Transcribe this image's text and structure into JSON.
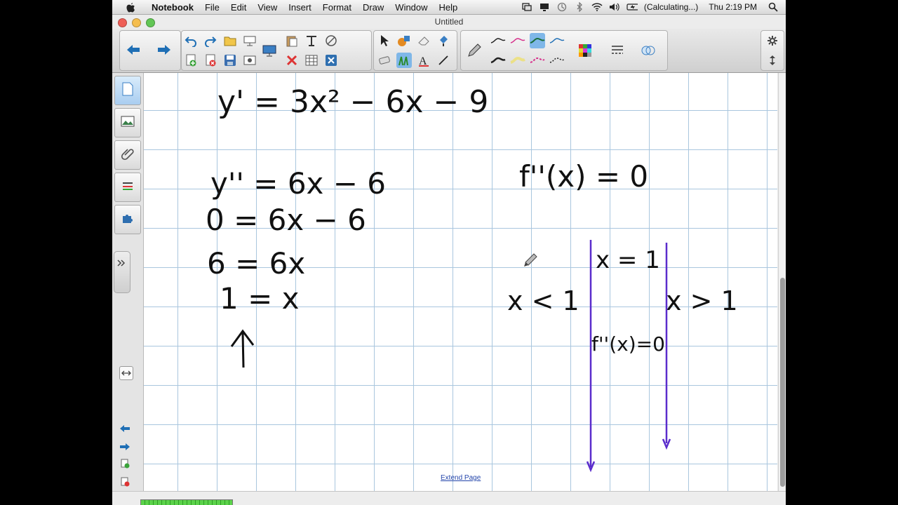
{
  "menubar": {
    "app_name": "Notebook",
    "items": [
      "File",
      "Edit",
      "View",
      "Insert",
      "Format",
      "Draw",
      "Window",
      "Help"
    ],
    "battery": "(Calculating...)",
    "clock": "Thu 2:19 PM"
  },
  "window": {
    "title": "Untitled"
  },
  "toolbar": {
    "buttons": [
      "back",
      "forward",
      "undo",
      "redo",
      "open",
      "save",
      "cut-blank",
      "display",
      "paste",
      "table",
      "fill",
      "select",
      "shapes",
      "eraser",
      "pen",
      "text",
      "line",
      "creative-pen",
      "pen-styles",
      "color",
      "line-style",
      "screen-shade",
      "properties",
      "settings",
      "move-toolbar"
    ]
  },
  "sidebar": {
    "tabs": [
      "page-sorter",
      "gallery",
      "attachments",
      "properties",
      "addons"
    ],
    "bottom_nav": [
      "previous-page",
      "next-page",
      "add-page",
      "delete-page"
    ]
  },
  "canvas": {
    "extend_link": "Extend Page",
    "handwriting": {
      "line1": "y' = 3x² − 6x − 9",
      "line2": "y'' = 6x − 6",
      "line3": "0 = 6x − 6",
      "line4": "6 = 6x",
      "line5": "1 = x",
      "right1": "f''(x) = 0",
      "right2": "x = 1",
      "right3": "x < 1",
      "right4": "x > 1",
      "right5": "f''(x)=0"
    }
  }
}
